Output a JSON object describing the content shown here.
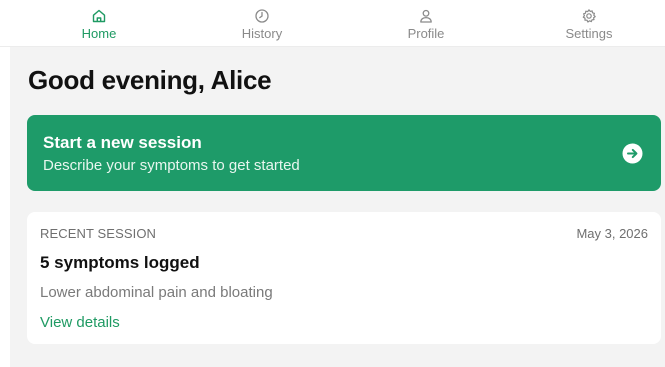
{
  "tabs": [
    {
      "label": "Home",
      "icon": "home-icon",
      "active": true
    },
    {
      "label": "History",
      "icon": "clock-icon",
      "active": false
    },
    {
      "label": "Profile",
      "icon": "person-icon",
      "active": false
    },
    {
      "label": "Settings",
      "icon": "gear-icon",
      "active": false
    }
  ],
  "greeting": "Good evening, Alice",
  "cta": {
    "title": "Start a new session",
    "subtitle": "Describe your symptoms to get started",
    "icon": "arrow-right-circle-icon"
  },
  "recent": {
    "eyebrow": "RECENT SESSION",
    "date": "May 3, 2026",
    "title": "5 symptoms logged",
    "summary": "Lower abdominal pain and bloating",
    "link": "View details"
  },
  "colors": {
    "accent": "#1e9b69",
    "active_tab": "#1f9a63",
    "inactive_tab": "#8a8a8a",
    "background": "#f3f3f3"
  }
}
